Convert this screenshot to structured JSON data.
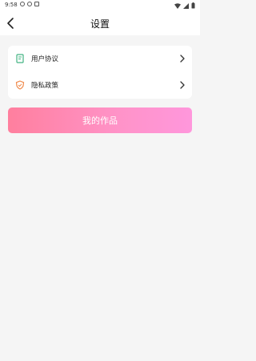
{
  "status_bar": {
    "time": "9:58"
  },
  "header": {
    "title": "设置"
  },
  "menu": {
    "items": [
      {
        "label": "用户协议",
        "icon": "document-icon",
        "icon_color": "#43b383"
      },
      {
        "label": "隐私政策",
        "icon": "shield-icon",
        "icon_color": "#f08a4b"
      }
    ]
  },
  "actions": {
    "my_works_label": "我的作品"
  },
  "colors": {
    "accent_start": "#ff7f9e",
    "accent_end": "#ff97dc",
    "background": "#f5f5f5"
  }
}
